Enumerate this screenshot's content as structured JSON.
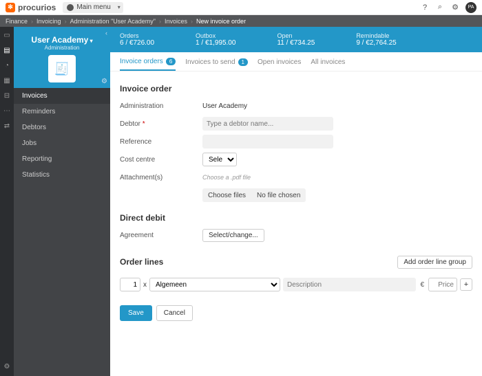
{
  "brand": "procurios",
  "mainmenu": "Main menu",
  "avatar": "PA",
  "breadcrumb": [
    "Finance",
    "Invoicing",
    "Administration \"User Academy\"",
    "Invoices"
  ],
  "breadcrumb_current": "New invoice order",
  "side": {
    "title": "User Academy",
    "subtitle": "Administration",
    "items": [
      "Invoices",
      "Reminders",
      "Debtors",
      "Jobs",
      "Reporting",
      "Statistics"
    ]
  },
  "stats": [
    {
      "label": "Orders",
      "value": "6 / €726.00"
    },
    {
      "label": "Outbox",
      "value": "1 / €1,995.00"
    },
    {
      "label": "Open",
      "value": "11 / €734.25"
    },
    {
      "label": "Remindable",
      "value": "9 / €2,764.25"
    }
  ],
  "tabs": [
    {
      "label": "Invoice orders",
      "badge": "6",
      "active": true
    },
    {
      "label": "Invoices to send",
      "badge": "1"
    },
    {
      "label": "Open invoices"
    },
    {
      "label": "All invoices"
    }
  ],
  "form": {
    "section1": "Invoice order",
    "admin_label": "Administration",
    "admin_value": "User Academy",
    "debtor_label": "Debtor",
    "debtor_placeholder": "Type a debtor name...",
    "reference_label": "Reference",
    "costcentre_label": "Cost centre",
    "costcentre_value": "Select...",
    "attachments_label": "Attachment(s)",
    "attachments_hint": "Choose a .pdf file",
    "choosefiles": "Choose files",
    "nofile": "No file chosen",
    "section2": "Direct debit",
    "agreement_label": "Agreement",
    "selectchange": "Select/change...",
    "section3": "Order lines",
    "addgroup": "Add order line group",
    "qty": "1",
    "x": "x",
    "line_select": "Algemeen",
    "desc_placeholder": "Description",
    "currency": "€",
    "price_placeholder": "Price",
    "save": "Save",
    "cancel": "Cancel"
  }
}
